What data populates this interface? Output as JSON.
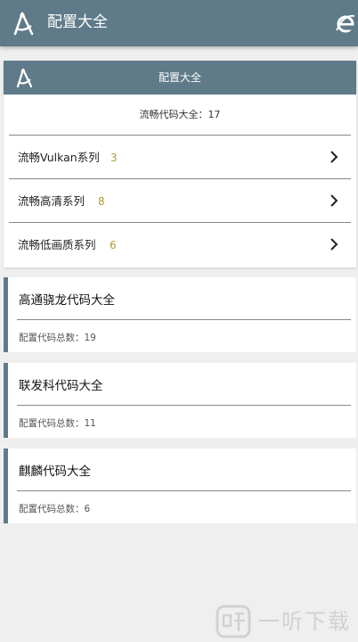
{
  "app": {
    "title": "配置大全"
  },
  "card": {
    "header_title": "配置大全",
    "summary": "流畅代码大全：17",
    "rows": [
      {
        "label": "流畅Vulkan系列",
        "count": "3"
      },
      {
        "label": "流畅高清系列",
        "count": "8"
      },
      {
        "label": "流畅低画质系列",
        "count": "6"
      }
    ]
  },
  "vendors": [
    {
      "title": "高通骁龙代码大全",
      "subtitle": "配置代码总数：19"
    },
    {
      "title": "联发科代码大全",
      "subtitle": "配置代码总数：11"
    },
    {
      "title": "麒麟代码大全",
      "subtitle": "配置代码总数：6"
    }
  ],
  "watermark": {
    "text": "一听下载"
  },
  "colors": {
    "appbar": "#5f7a89",
    "accent_count": "#b09a3a",
    "background": "#efefef"
  },
  "icons": {
    "app_logo": "compass-icon",
    "browser": "ie-browser-icon",
    "row_arrow": "chevron-right-icon"
  }
}
